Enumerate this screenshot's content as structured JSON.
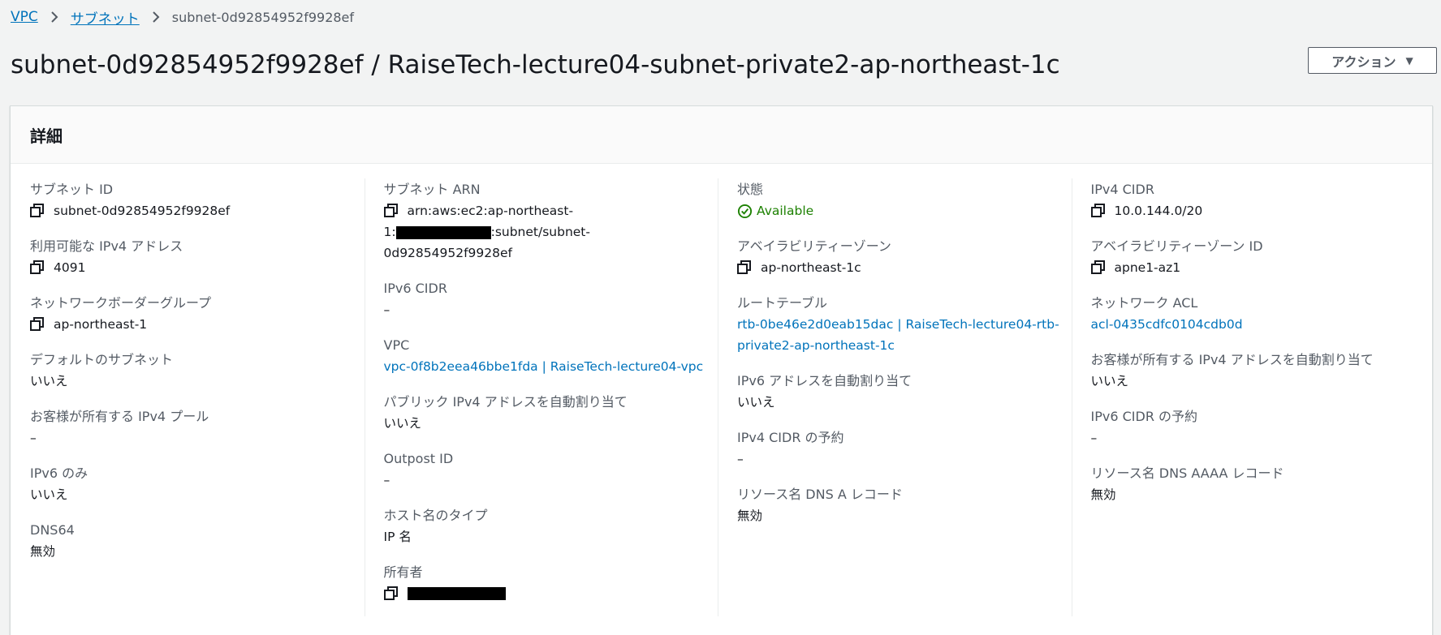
{
  "breadcrumb": {
    "items": [
      "VPC",
      "サブネット"
    ],
    "current": "subnet-0d92854952f9928ef"
  },
  "title": "subnet-0d92854952f9928ef / RaiseTech-lecture04-subnet-private2-ap-northeast-1c",
  "actions_label": "アクション",
  "panel": {
    "heading": "詳細"
  },
  "col1": {
    "subnet_id": {
      "label": "サブネット ID",
      "value": "subnet-0d92854952f9928ef"
    },
    "available_ipv4": {
      "label": "利用可能な IPv4 アドレス",
      "value": "4091"
    },
    "network_border_group": {
      "label": "ネットワークボーダーグループ",
      "value": "ap-northeast-1"
    },
    "default_subnet": {
      "label": "デフォルトのサブネット",
      "value": "いいえ"
    },
    "customer_ipv4_pool": {
      "label": "お客様が所有する IPv4 プール",
      "value": "–"
    },
    "ipv6_only": {
      "label": "IPv6 のみ",
      "value": "いいえ"
    },
    "dns64": {
      "label": "DNS64",
      "value": "無効"
    }
  },
  "col2": {
    "subnet_arn": {
      "label": "サブネット ARN",
      "line1": "arn:aws:ec2:ap-northeast-",
      "line2_prefix": "1:",
      "line2_suffix": ":subnet/subnet-",
      "line3": "0d92854952f9928ef"
    },
    "ipv6_cidr": {
      "label": "IPv6 CIDR",
      "value": "–"
    },
    "vpc": {
      "label": "VPC",
      "value": "vpc-0f8b2eea46bbe1fda | RaiseTech-lecture04-vpc"
    },
    "auto_assign_public_ipv4": {
      "label": "パブリック IPv4 アドレスを自動割り当て",
      "value": "いいえ"
    },
    "outpost_id": {
      "label": "Outpost ID",
      "value": "–"
    },
    "hostname_type": {
      "label": "ホスト名のタイプ",
      "value": "IP 名"
    },
    "owner": {
      "label": "所有者"
    }
  },
  "col3": {
    "state": {
      "label": "状態",
      "value": "Available"
    },
    "az": {
      "label": "アベイラビリティーゾーン",
      "value": "ap-northeast-1c"
    },
    "route_table": {
      "label": "ルートテーブル",
      "line1": "rtb-0be46e2d0eab15dac | RaiseTech-lecture04-rtb-",
      "line2": "private2-ap-northeast-1c"
    },
    "auto_assign_ipv6": {
      "label": "IPv6 アドレスを自動割り当て",
      "value": "いいえ"
    },
    "ipv4_cidr_reservation": {
      "label": "IPv4 CIDR の予約",
      "value": "–"
    },
    "resource_dns_a": {
      "label": "リソース名 DNS A レコード",
      "value": "無効"
    }
  },
  "col4": {
    "ipv4_cidr": {
      "label": "IPv4 CIDR",
      "value": "10.0.144.0/20"
    },
    "az_id": {
      "label": "アベイラビリティーゾーン ID",
      "value": "apne1-az1"
    },
    "network_acl": {
      "label": "ネットワーク ACL",
      "value": "acl-0435cdfc0104cdb0d"
    },
    "auto_assign_customer_ipv4": {
      "label": "お客様が所有する IPv4 アドレスを自動割り当て",
      "value": "いいえ"
    },
    "ipv6_cidr_reservation": {
      "label": "IPv6 CIDR の予約",
      "value": "–"
    },
    "resource_dns_aaaa": {
      "label": "リソース名 DNS AAAA レコード",
      "value": "無効"
    }
  },
  "colors": {
    "link": "#0073bb",
    "success": "#1d8102",
    "label": "#545b64",
    "background": "#f2f3f3"
  },
  "icons": [
    "chevron-right-icon",
    "copy-icon",
    "status-success-icon",
    "caret-down-icon"
  ]
}
